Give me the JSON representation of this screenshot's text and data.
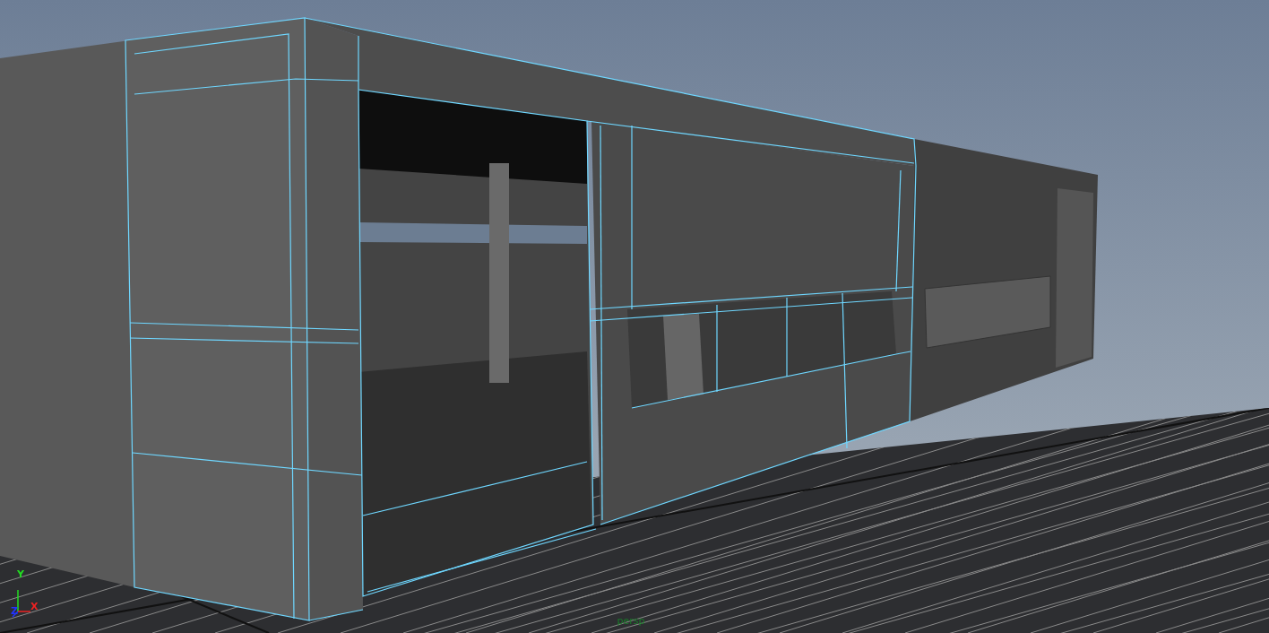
{
  "viewport": {
    "camera_label": "persp",
    "axes": [
      {
        "label": "Y",
        "color": "#22dd22"
      },
      {
        "label": "Z",
        "color": "#2233ff"
      },
      {
        "label": "X",
        "color": "#ee2222"
      }
    ]
  }
}
